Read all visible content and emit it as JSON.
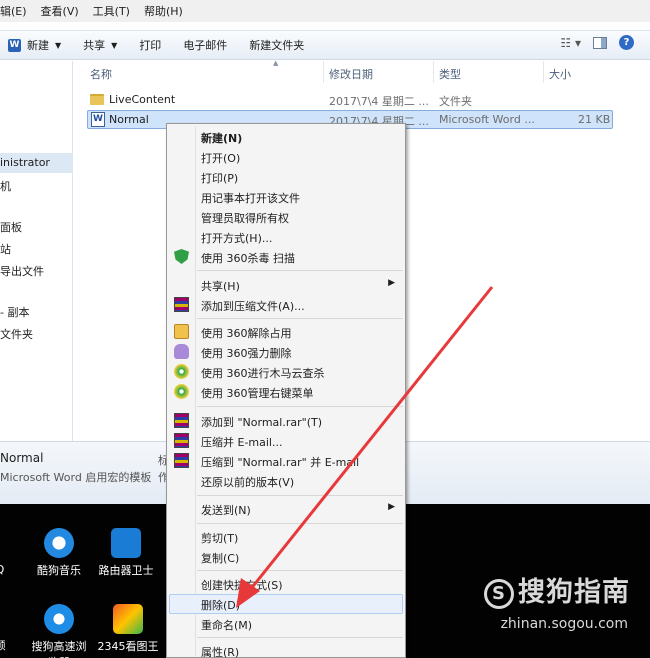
{
  "menubar": {
    "items": [
      "辑(E)",
      "查看(V)",
      "工具(T)",
      "帮助(H)"
    ]
  },
  "toolbar": {
    "new_label": "新建",
    "share_label": "共享",
    "print_label": "打印",
    "email_label": "电子邮件",
    "newfolder_label": "新建文件夹"
  },
  "nav": {
    "items": [
      "inistrator",
      "机",
      "面板",
      "站",
      "导出文件",
      "- 副本",
      "文件夹"
    ]
  },
  "columns": {
    "name": "名称",
    "date": "修改日期",
    "type": "类型",
    "size": "大小"
  },
  "files": [
    {
      "name": "LiveContent",
      "date": "2017\\7\\4 星期二 ...",
      "type": "文件夹",
      "size": ""
    },
    {
      "name": "Normal",
      "date": "2017\\7\\4 星期二 ...",
      "type": "Microsoft Word ...",
      "size": "21 KB"
    }
  ],
  "details": {
    "name": "Normal",
    "type": "Microsoft Word 启用宏的模板",
    "label1": "标",
    "label2": "作"
  },
  "context_menu": {
    "new": "新建(N)",
    "open": "打开(O)",
    "print": "打印(P)",
    "notepad": "用记事本打开该文件",
    "admin": "管理员取得所有权",
    "openwith": "打开方式(H)...",
    "scan360": "使用 360杀毒 扫描",
    "share": "共享(H)",
    "addarchive": "添加到压缩文件(A)...",
    "unlock360": "使用 360解除占用",
    "forcedel360": "使用 360强力删除",
    "trojan360": "使用 360进行木马云查杀",
    "menu360": "使用 360管理右键菜单",
    "addrar": "添加到 \"Normal.rar\"(T)",
    "zipemail": "压缩并 E-mail...",
    "rar_email": "压缩到 \"Normal.rar\" 并 E-mail",
    "restore": "还原以前的版本(V)",
    "sendto": "发送到(N)",
    "cut": "剪切(T)",
    "copy": "复制(C)",
    "shortcut": "创建快捷方式(S)",
    "delete": "删除(D)",
    "rename": "重命名(M)",
    "props": "属性(R)"
  },
  "desktop": {
    "left1": "Q",
    "kugou": "酷狗音乐",
    "router": "路由器卫士",
    "left2": "频",
    "sogou_browser": "搜狗高速浏",
    "sogou_browser2": "览器",
    "pic2345": "2345看图王"
  },
  "watermark": {
    "brand": "搜狗指南",
    "url": "zhinan.sogou.com",
    "logo_letter": "S"
  },
  "colors": {
    "arrow": "#e8393a",
    "selection": "#cfe3fb"
  }
}
